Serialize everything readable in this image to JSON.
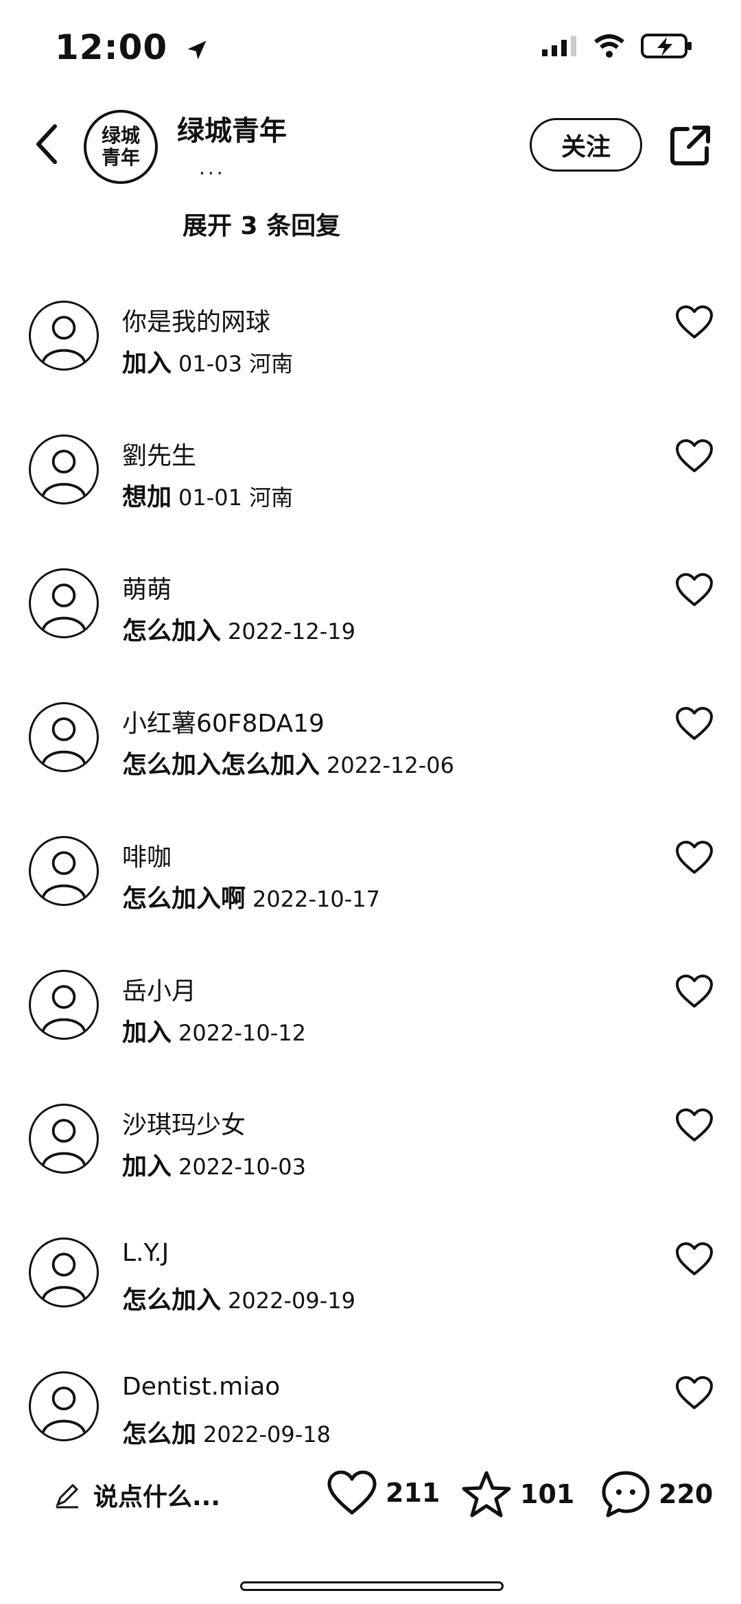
{
  "status": {
    "time": "12:00"
  },
  "header": {
    "avatar_text": "绿城\n青年",
    "title": "绿城青年",
    "subtitle": "...",
    "follow_label": "关注"
  },
  "expand_label": "展开 3 条回复",
  "comments": [
    {
      "name": "你是我的网球",
      "text": "加入",
      "meta": "01-03 河南"
    },
    {
      "name": "劉先生",
      "text": "想加",
      "meta": "01-01 河南"
    },
    {
      "name": "萌萌",
      "text": "怎么加入",
      "meta": "2022-12-19"
    },
    {
      "name": "小红薯60F8DA19",
      "text": "怎么加入怎么加入",
      "meta": "2022-12-06"
    },
    {
      "name": "啡咖",
      "text": "怎么加入啊",
      "meta": "2022-10-17"
    },
    {
      "name": "岳小月",
      "text": "加入",
      "meta": "2022-10-12"
    },
    {
      "name": "沙琪玛少女",
      "text": "加入",
      "meta": "2022-10-03"
    },
    {
      "name": "L.Y.J",
      "text": "怎么加入",
      "meta": "2022-09-19"
    },
    {
      "name": "Dentist.miao",
      "text": "怎么加",
      "meta": "2022-09-18"
    }
  ],
  "bottom": {
    "placeholder": "说点什么...",
    "likes": "211",
    "stars": "101",
    "comments": "220"
  }
}
